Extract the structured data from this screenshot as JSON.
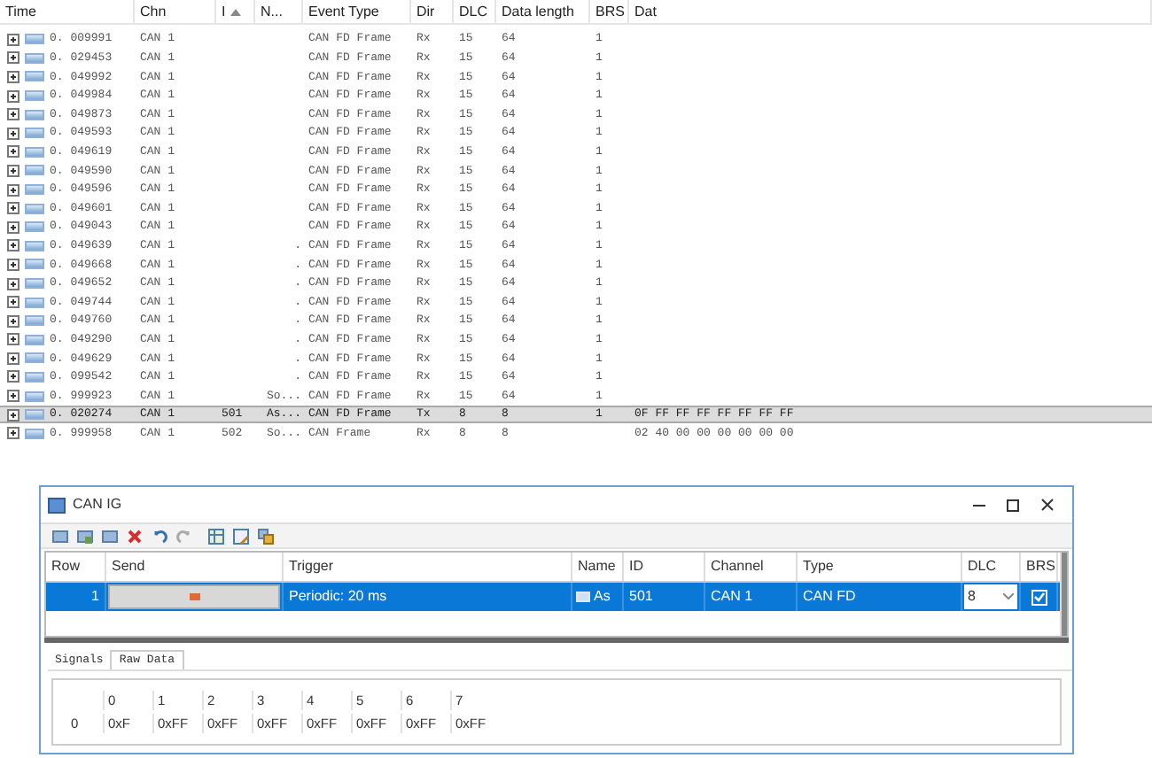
{
  "trace": {
    "columns": [
      {
        "label": "Time",
        "sorted": false
      },
      {
        "label": "Chn",
        "sorted": false
      },
      {
        "label": "I",
        "sorted": true
      },
      {
        "label": "N...",
        "sorted": false
      },
      {
        "label": "Event Type",
        "sorted": false
      },
      {
        "label": "Dir",
        "sorted": false
      },
      {
        "label": "DLC",
        "sorted": false
      },
      {
        "label": "Data length",
        "sorted": false
      },
      {
        "label": "BRS",
        "sorted": false
      },
      {
        "label": "Dat",
        "sorted": false
      }
    ],
    "rows": [
      {
        "time": "0. 009991",
        "channel": "CAN 1",
        "event_type": "CAN FD Frame",
        "dir": "Rx",
        "dlc": "15",
        "data_length": "64",
        "brs": "1",
        "selected": false
      },
      {
        "time": "0. 029453",
        "channel": "CAN 1",
        "event_type": "CAN FD Frame",
        "dir": "Rx",
        "dlc": "15",
        "data_length": "64",
        "brs": "1",
        "selected": false
      },
      {
        "time": "0. 049992",
        "channel": "CAN 1",
        "event_type": "CAN FD Frame",
        "dir": "Rx",
        "dlc": "15",
        "data_length": "64",
        "brs": "1",
        "selected": false
      },
      {
        "time": "0. 049984",
        "channel": "CAN 1",
        "event_type": "CAN FD Frame",
        "dir": "Rx",
        "dlc": "15",
        "data_length": "64",
        "brs": "1",
        "selected": false
      },
      {
        "time": "0. 049873",
        "channel": "CAN 1",
        "event_type": "CAN FD Frame",
        "dir": "Rx",
        "dlc": "15",
        "data_length": "64",
        "brs": "1",
        "selected": false
      },
      {
        "time": "0. 049593",
        "channel": "CAN 1",
        "event_type": "CAN FD Frame",
        "dir": "Rx",
        "dlc": "15",
        "data_length": "64",
        "brs": "1",
        "selected": false
      },
      {
        "time": "0. 049619",
        "channel": "CAN 1",
        "event_type": "CAN FD Frame",
        "dir": "Rx",
        "dlc": "15",
        "data_length": "64",
        "brs": "1",
        "selected": false
      },
      {
        "time": "0. 049590",
        "channel": "CAN 1",
        "event_type": "CAN FD Frame",
        "dir": "Rx",
        "dlc": "15",
        "data_length": "64",
        "brs": "1",
        "selected": false
      },
      {
        "time": "0. 049596",
        "channel": "CAN 1",
        "event_type": "CAN FD Frame",
        "dir": "Rx",
        "dlc": "15",
        "data_length": "64",
        "brs": "1",
        "selected": false
      },
      {
        "time": "0. 049601",
        "channel": "CAN 1",
        "event_type": "CAN FD Frame",
        "dir": "Rx",
        "dlc": "15",
        "data_length": "64",
        "brs": "1",
        "selected": false
      },
      {
        "time": "0. 049043",
        "channel": "CAN 1",
        "event_type": "CAN FD Frame",
        "dir": "Rx",
        "dlc": "15",
        "data_length": "64",
        "brs": "1",
        "selected": false
      },
      {
        "time": "0. 049639",
        "channel": "CAN 1",
        "name": ".",
        "event_type": "CAN FD Frame",
        "dir": "Rx",
        "dlc": "15",
        "data_length": "64",
        "brs": "1",
        "selected": false
      },
      {
        "time": "0. 049668",
        "channel": "CAN 1",
        "name": ".",
        "event_type": "CAN FD Frame",
        "dir": "Rx",
        "dlc": "15",
        "data_length": "64",
        "brs": "1",
        "selected": false
      },
      {
        "time": "0. 049652",
        "channel": "CAN 1",
        "name": ".",
        "event_type": "CAN FD Frame",
        "dir": "Rx",
        "dlc": "15",
        "data_length": "64",
        "brs": "1",
        "selected": false
      },
      {
        "time": "0. 049744",
        "channel": "CAN 1",
        "name": ".",
        "event_type": "CAN FD Frame",
        "dir": "Rx",
        "dlc": "15",
        "data_length": "64",
        "brs": "1",
        "selected": false
      },
      {
        "time": "0. 049760",
        "channel": "CAN 1",
        "name": ".",
        "event_type": "CAN FD Frame",
        "dir": "Rx",
        "dlc": "15",
        "data_length": "64",
        "brs": "1",
        "selected": false
      },
      {
        "time": "0. 049290",
        "channel": "CAN 1",
        "name": ".",
        "event_type": "CAN FD Frame",
        "dir": "Rx",
        "dlc": "15",
        "data_length": "64",
        "brs": "1",
        "selected": false
      },
      {
        "time": "0. 049629",
        "channel": "CAN 1",
        "name": ".",
        "event_type": "CAN FD Frame",
        "dir": "Rx",
        "dlc": "15",
        "data_length": "64",
        "brs": "1",
        "selected": false
      },
      {
        "time": "0. 099542",
        "channel": "CAN 1",
        "name": ".",
        "event_type": "CAN FD Frame",
        "dir": "Rx",
        "dlc": "15",
        "data_length": "64",
        "brs": "1",
        "selected": false
      },
      {
        "time": "0. 999923",
        "channel": "CAN 1",
        "name": "So...",
        "event_type": "CAN FD Frame",
        "dir": "Rx",
        "dlc": "15",
        "data_length": "64",
        "brs": "1",
        "selected": false
      },
      {
        "time": "0. 020274",
        "channel": "CAN 1",
        "id": "501",
        "name": "As...",
        "event_type": "CAN FD Frame",
        "dir": "Tx",
        "dlc": "8",
        "data_length": "8",
        "brs": "1",
        "data": "0F FF FF FF FF FF FF FF",
        "selected": true
      },
      {
        "time": "0. 999958",
        "channel": "CAN 1",
        "id": "502",
        "name": "So...",
        "event_type": "CAN Frame",
        "dir": "Rx",
        "dlc": "8",
        "data_length": "8",
        "data": "02 40 00 00 00 00 00 00",
        "selected": false
      }
    ]
  },
  "window": {
    "title": "CAN IG"
  },
  "grid": {
    "columns": [
      "Row",
      "Send",
      "Trigger",
      "Name",
      "ID",
      "Channel",
      "Type",
      "DLC",
      "BRS"
    ],
    "rows": [
      {
        "row": "1",
        "trigger": "Periodic: 20 ms",
        "name": "As",
        "id": "501",
        "channel": "CAN 1",
        "type": "CAN FD",
        "dlc": "8",
        "brs": true,
        "selected": true
      }
    ]
  },
  "tabs": [
    {
      "label": "Signals",
      "selected": false
    },
    {
      "label": "Raw Data",
      "selected": true
    }
  ],
  "raw_data": {
    "columns": [
      "0",
      "1",
      "2",
      "3",
      "4",
      "5",
      "6",
      "7"
    ],
    "rows": [
      {
        "label": "0",
        "values": [
          "0xF",
          "0xFF",
          "0xFF",
          "0xFF",
          "0xFF",
          "0xFF",
          "0xFF",
          "0xFF"
        ]
      }
    ]
  }
}
